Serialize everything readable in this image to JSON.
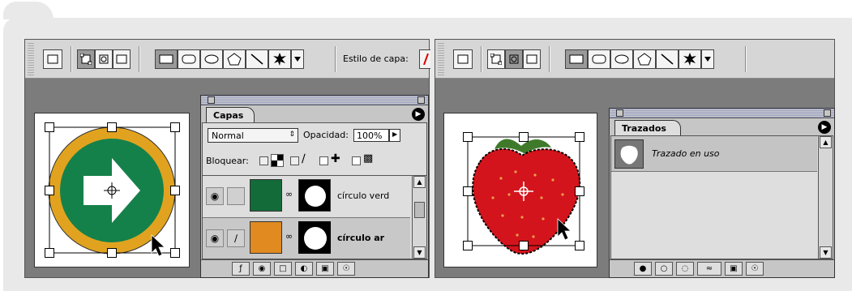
{
  "left_window": {
    "toolbar": {
      "style_label": "Estilo de capa:"
    },
    "layers_panel": {
      "tab_label": "Capas",
      "blend_mode": "Normal",
      "opacity_label": "Opacidad:",
      "opacity_value": "100%",
      "lock_label": "Bloquear:",
      "layers": [
        {
          "name": "círculo verd",
          "thumb_color": "#146b3a",
          "bold": false
        },
        {
          "name": "círculo ar",
          "thumb_color": "#e08a20",
          "bold": true
        }
      ]
    },
    "artwork": {
      "ring_color": "#e1a31f",
      "disc_color": "#15814a",
      "arrow_color": "#ffffff"
    }
  },
  "right_window": {
    "paths_panel": {
      "tab_label": "Trazados",
      "path_name": "Trazado en uso"
    },
    "artwork": {
      "fruit_color": "#d4141c"
    }
  },
  "icons": {
    "menu": "circle-arrow-menu-icon",
    "eye": "eye-icon",
    "brush": "brush-icon",
    "chain": "chain-link-icon",
    "trash": "trash-icon",
    "new_layer": "new-layer-icon",
    "folder": "folder-icon",
    "lock": "lock-icon",
    "move": "move-icon",
    "cursor": "arrow-cursor-icon",
    "crosshair": "crosshair-icon"
  }
}
